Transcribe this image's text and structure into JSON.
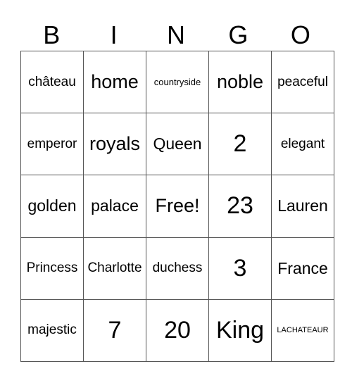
{
  "header": [
    "B",
    "I",
    "N",
    "G",
    "O"
  ],
  "rows": [
    [
      {
        "text": "château",
        "size": "md"
      },
      {
        "text": "home",
        "size": "xl"
      },
      {
        "text": "countryside",
        "size": "sm"
      },
      {
        "text": "noble",
        "size": "xl"
      },
      {
        "text": "peaceful",
        "size": "md"
      }
    ],
    [
      {
        "text": "emperor",
        "size": "md"
      },
      {
        "text": "royals",
        "size": "xl"
      },
      {
        "text": "Queen",
        "size": "lg"
      },
      {
        "text": "2",
        "size": "xxl"
      },
      {
        "text": "elegant",
        "size": "md"
      }
    ],
    [
      {
        "text": "golden",
        "size": "lg"
      },
      {
        "text": "palace",
        "size": "lg"
      },
      {
        "text": "Free!",
        "size": "xl"
      },
      {
        "text": "23",
        "size": "xxl"
      },
      {
        "text": "Lauren",
        "size": "lg"
      }
    ],
    [
      {
        "text": "Princess",
        "size": "md"
      },
      {
        "text": "Charlotte",
        "size": "md"
      },
      {
        "text": "duchess",
        "size": "md"
      },
      {
        "text": "3",
        "size": "xxl"
      },
      {
        "text": "France",
        "size": "lg"
      }
    ],
    [
      {
        "text": "majestic",
        "size": "md"
      },
      {
        "text": "7",
        "size": "xxl"
      },
      {
        "text": "20",
        "size": "xxl"
      },
      {
        "text": "King",
        "size": "xxl"
      },
      {
        "text": "LACHATEAUR",
        "size": "xs"
      }
    ]
  ]
}
